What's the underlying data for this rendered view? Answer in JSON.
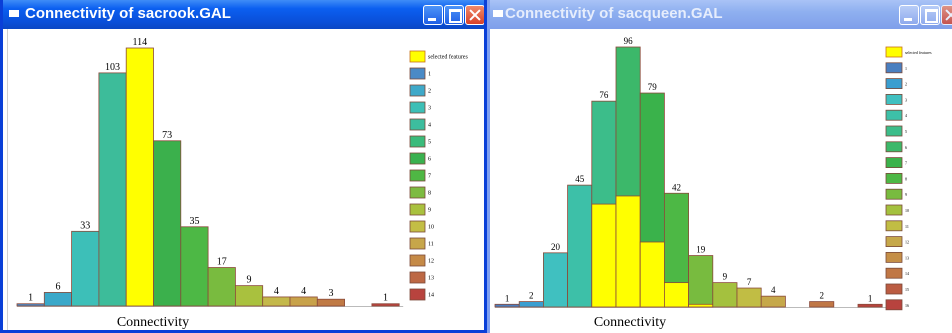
{
  "windows": [
    {
      "title": "Connectivity of sacrook.GAL",
      "active": true,
      "buttons": {
        "minimize_icon": "minimize-icon",
        "maximize_icon": "maximize-icon",
        "close_icon": "close-icon"
      },
      "chart_data": {
        "type": "bar",
        "title": "",
        "xlabel": "Connectivity",
        "ylabel": "",
        "ylim": [
          0,
          114
        ],
        "values": [
          1,
          6,
          33,
          103,
          114,
          73,
          35,
          17,
          9,
          4,
          4,
          3,
          0,
          1
        ],
        "data_labels": [
          "1",
          "6",
          "33",
          "103",
          "114",
          "73",
          "35",
          "17",
          "9",
          "4",
          "4",
          "3",
          "",
          "1"
        ],
        "bar_colors": [
          "#4d86c0",
          "#3aa8c9",
          "#3dbfb8",
          "#3dbc9a",
          "#ffff00",
          "#3bb04c",
          "#4db845",
          "#79bb3f",
          "#a9c13e",
          "#c4b84a",
          "#c8a24a",
          "#c07a45",
          "#b85a42",
          "#b8433e"
        ],
        "legend": {
          "placement": "right",
          "entries": [
            {
              "label": "selected features",
              "color": "#ffff00"
            },
            {
              "label": "1",
              "color": "#4a8ac6"
            },
            {
              "label": "2",
              "color": "#3fa9c9"
            },
            {
              "label": "3",
              "color": "#3dbfb6"
            },
            {
              "label": "4",
              "color": "#3dbd9e"
            },
            {
              "label": "5",
              "color": "#3bbb7b"
            },
            {
              "label": "6",
              "color": "#3ab14f"
            },
            {
              "label": "7",
              "color": "#4fb744"
            },
            {
              "label": "8",
              "color": "#7dbb41"
            },
            {
              "label": "9",
              "color": "#a9c13e"
            },
            {
              "label": "10",
              "color": "#c3be45"
            },
            {
              "label": "11",
              "color": "#c7a64a"
            },
            {
              "label": "12",
              "color": "#c58a47"
            },
            {
              "label": "13",
              "color": "#bd6844"
            },
            {
              "label": "14",
              "color": "#b8433e"
            }
          ]
        }
      }
    },
    {
      "title": "Connectivity of sacqueen.GAL",
      "active": false,
      "buttons": {
        "minimize_icon": "minimize-icon",
        "maximize_icon": "maximize-icon",
        "close_icon": "close-icon"
      },
      "chart_data": {
        "type": "bar",
        "title": "",
        "xlabel": "Connectivity",
        "ylabel": "",
        "ylim": [
          0,
          96
        ],
        "values": [
          1,
          2,
          20,
          45,
          76,
          96,
          79,
          42,
          19,
          9,
          7,
          4,
          0,
          2,
          0,
          1
        ],
        "selected": [
          0,
          0,
          0,
          0,
          38,
          41,
          24,
          9,
          1,
          0,
          0,
          0,
          0,
          0,
          0,
          0
        ],
        "data_labels": [
          "1",
          "2",
          "20",
          "45",
          "76",
          "96",
          "79",
          "42",
          "19",
          "9",
          "7",
          "4",
          "",
          "2",
          "",
          "1"
        ],
        "bar_colors": [
          "#4a7fc0",
          "#3a9ed0",
          "#40c0c0",
          "#3dc0a8",
          "#3cbd8a",
          "#3cb86a",
          "#3ab24b",
          "#4db845",
          "#78bb3f",
          "#a4c13e",
          "#c1bd44",
          "#c6a84a",
          "#c58f47",
          "#c07745",
          "#bb5c42",
          "#b8433e"
        ],
        "legend": {
          "placement": "right",
          "entries": [
            {
              "label": "selected features",
              "color": "#ffff00"
            },
            {
              "label": "1",
              "color": "#4a7fc0"
            },
            {
              "label": "2",
              "color": "#3a9ed0"
            },
            {
              "label": "3",
              "color": "#40c0c0"
            },
            {
              "label": "4",
              "color": "#3dc0a8"
            },
            {
              "label": "5",
              "color": "#3cbd8a"
            },
            {
              "label": "6",
              "color": "#3cb86a"
            },
            {
              "label": "7",
              "color": "#3ab24b"
            },
            {
              "label": "8",
              "color": "#4db845"
            },
            {
              "label": "9",
              "color": "#78bb3f"
            },
            {
              "label": "10",
              "color": "#a4c13e"
            },
            {
              "label": "11",
              "color": "#c1bd44"
            },
            {
              "label": "12",
              "color": "#c6a84a"
            },
            {
              "label": "13",
              "color": "#c58f47"
            },
            {
              "label": "14",
              "color": "#c07745"
            },
            {
              "label": "15",
              "color": "#bb5c42"
            },
            {
              "label": "16",
              "color": "#b8433e"
            }
          ]
        }
      }
    }
  ]
}
